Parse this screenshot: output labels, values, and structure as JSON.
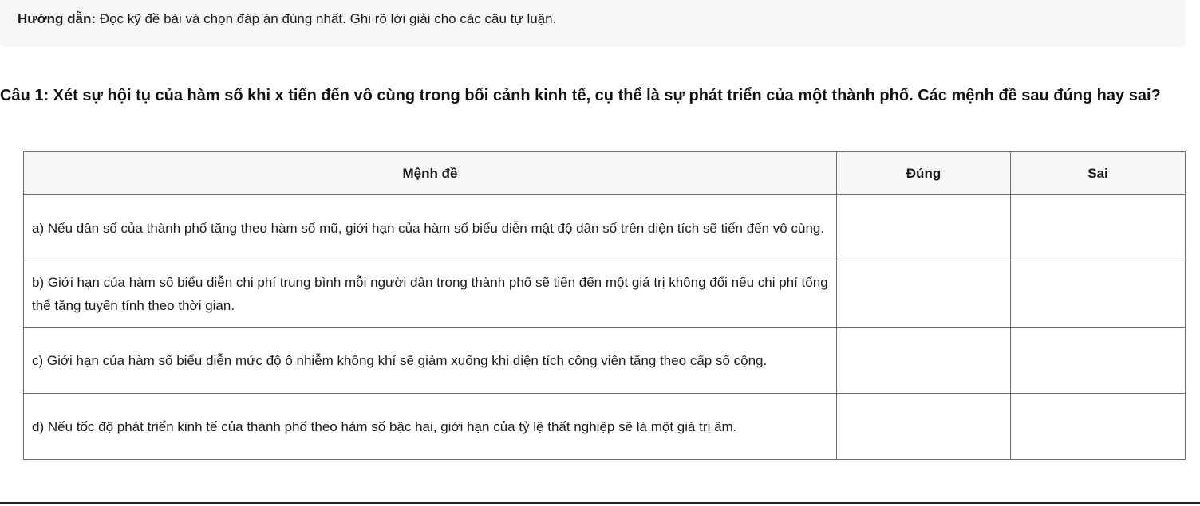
{
  "instructions": {
    "label": "Hướng dẫn:",
    "text": " Đọc kỹ đề bài và chọn đáp án đúng nhất. Ghi rõ lời giải cho các câu tự luận."
  },
  "question": {
    "text": "Câu 1: Xét sự hội tụ của hàm số khi x tiến đến vô cùng trong bối cảnh kinh tế, cụ thể là sự phát triển của một thành phố. Các mệnh đề sau đúng hay sai?"
  },
  "table": {
    "headers": [
      "Mệnh đề",
      "Đúng",
      "Sai"
    ],
    "rows": [
      {
        "statement": "a) Nếu dân số của thành phố tăng theo hàm số mũ, giới hạn của hàm số biểu diễn mật độ dân số trên diện tích sẽ tiến đến vô cùng.",
        "true_cell": "",
        "false_cell": ""
      },
      {
        "statement": "b) Giới hạn của hàm số biểu diễn chi phí trung bình mỗi người dân trong thành phố sẽ tiến đến một giá trị không đổi nếu chi phí tổng thể tăng tuyến tính theo thời gian.",
        "true_cell": "",
        "false_cell": ""
      },
      {
        "statement": "c) Giới hạn của hàm số biểu diễn mức độ ô nhiễm không khí sẽ giảm xuống khi diện tích công viên tăng theo cấp số cộng.",
        "true_cell": "",
        "false_cell": ""
      },
      {
        "statement": "d) Nếu tốc độ phát triển kinh tế của thành phố theo hàm số bậc hai, giới hạn của tỷ lệ thất nghiệp sẽ là một giá trị âm.",
        "true_cell": "",
        "false_cell": ""
      }
    ]
  }
}
